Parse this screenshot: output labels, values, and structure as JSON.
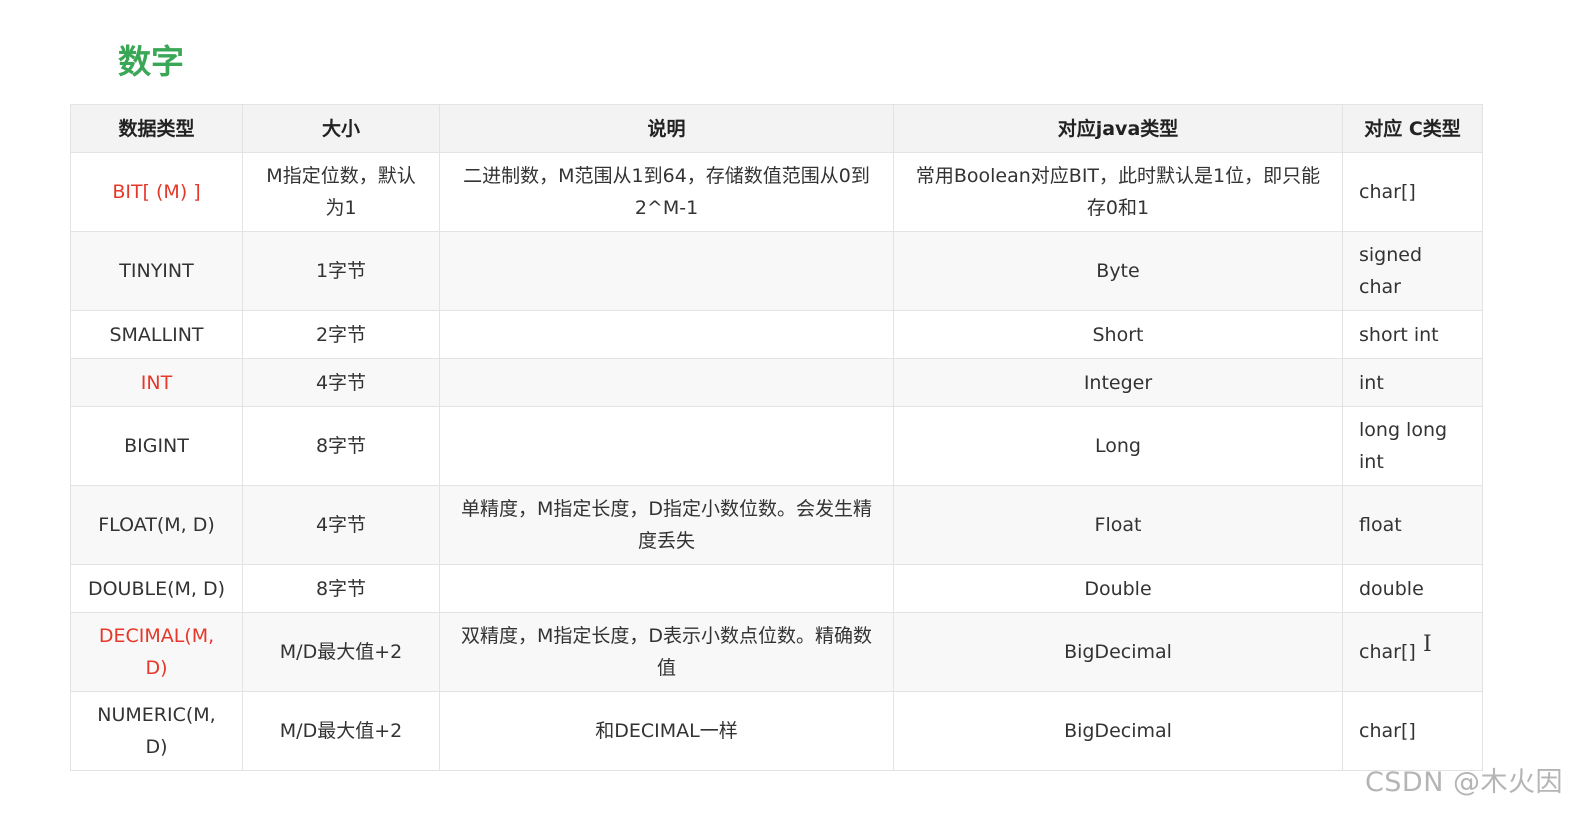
{
  "heading": "数字",
  "table": {
    "headers": [
      "数据类型",
      "大小",
      "说明",
      "对应java类型",
      "对应 C类型"
    ],
    "rows": [
      {
        "type": "BIT[ (M) ]",
        "size": "M指定位数，默认为1",
        "desc": "二进制数，M范围从1到64，存储数值范围从0到2^M-1",
        "java": "常用Boolean对应BIT，此时默认是1位，即只能存0和1",
        "c": "char[]",
        "highlight": true
      },
      {
        "type": "TINYINT",
        "size": "1字节",
        "desc": "",
        "java": "Byte",
        "c": "signed char",
        "highlight": false
      },
      {
        "type": "SMALLINT",
        "size": "2字节",
        "desc": "",
        "java": "Short",
        "c": "short int",
        "highlight": false
      },
      {
        "type": "INT",
        "size": "4字节",
        "desc": "",
        "java": "Integer",
        "c": "int",
        "highlight": true
      },
      {
        "type": "BIGINT",
        "size": "8字节",
        "desc": "",
        "java": "Long",
        "c": "long long int",
        "highlight": false
      },
      {
        "type": "FLOAT(M, D)",
        "size": "4字节",
        "desc": "单精度，M指定长度，D指定小数位数。会发生精度丢失",
        "java": "Float",
        "c": "float",
        "highlight": false
      },
      {
        "type": "DOUBLE(M, D)",
        "size": "8字节",
        "desc": "",
        "java": "Double",
        "c": "double",
        "highlight": false
      },
      {
        "type": "DECIMAL(M, D)",
        "size": "M/D最大值+2",
        "desc": "双精度，M指定长度，D表示小数点位数。精确数值",
        "java": "BigDecimal",
        "c": "char[]",
        "highlight": true
      },
      {
        "type": "NUMERIC(M, D)",
        "size": "M/D最大值+2",
        "desc": "和DECIMAL一样",
        "java": "BigDecimal",
        "c": "char[]",
        "highlight": false
      }
    ]
  },
  "cursor_glyph": "I",
  "watermark": "CSDN @木火因",
  "colors": {
    "heading": "#3aa757",
    "highlight_text": "#e5382a",
    "header_bg": "#f3f3f3",
    "stripe_bg": "#f8f8f8",
    "border": "#e3e3e3"
  }
}
